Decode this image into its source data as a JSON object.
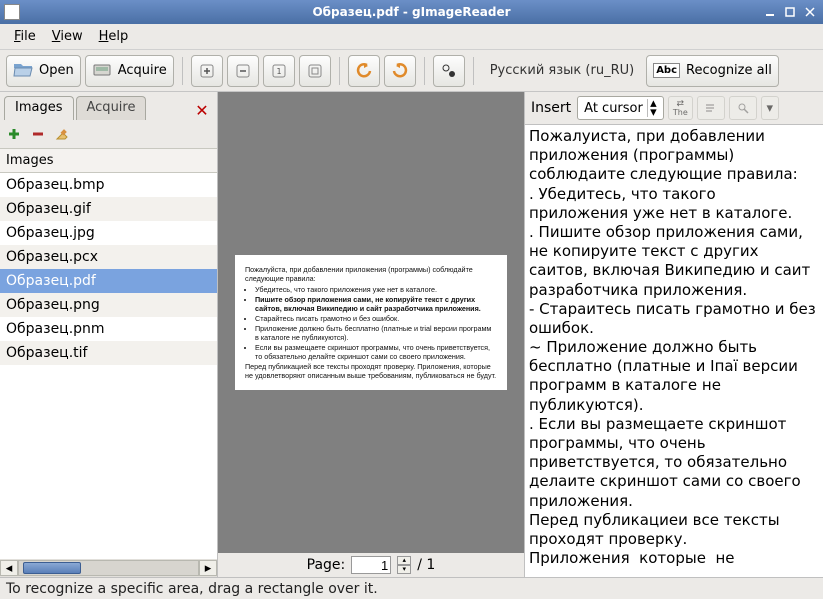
{
  "window": {
    "title": "Образец.pdf - gImageReader"
  },
  "menu": {
    "file": "File",
    "view": "View",
    "help": "Help"
  },
  "toolbar": {
    "open": "Open",
    "acquire": "Acquire",
    "language": "Русский язык (ru_RU)",
    "recognize_all": "Recognize all"
  },
  "left_panel": {
    "tab_images": "Images",
    "tab_acquire": "Acquire",
    "list_header": "Images",
    "files": [
      "Образец.bmp",
      "Образец.gif",
      "Образец.jpg",
      "Образец.pcx",
      "Образец.pdf",
      "Образец.png",
      "Образец.pnm",
      "Образец.tif"
    ],
    "selected_index": 4
  },
  "viewer": {
    "page_label": "Page:",
    "page_current": "1",
    "page_total": "/ 1",
    "doc": {
      "intro": "Пожалуйста, при добавлении приложения (программы) соблюдайте следующие правила:",
      "b1": "Убедитесь, что такого приложения уже нет в каталоге.",
      "b2": "Пишите обзор приложения сами, не копируйте текст с других сайтов, включая Википедию и сайт разработчика приложения.",
      "b3": "Старайтесь писать грамотно и без ошибок.",
      "b4": "Приложение должно быть бесплатно (платные и trial версии программ в каталоге не публикуются).",
      "b5": "Если вы размещаете скриншот программы, что очень приветствуется, то обязательно делайте скриншот сами со своего приложения.",
      "outro": "Перед публикацией все тексты проходят проверку. Приложения, которые не удовлетворяют описанным выше требованиям, публиковаться не будут."
    }
  },
  "output": {
    "insert_label": "Insert",
    "insert_mode": "At cursor",
    "the_label": "The",
    "text": "Пожалуиста, при добавлении приложения (программы) соблюдаите следующие правила:\n. Убедитесь, что такого приложения уже нет в каталоге.\n. Пишите обзор приложения сами, не копируите текст с других саитов, включая Википедию и саит разработчика приложения.\n- Стараитесь писать грамотно и без ошибок.\n~ Приложение должно быть бесплатно (платные и Іпаї версии программ в каталоге не публикуются).\n. Если вы размещаете скриншот программы, что очень приветствуется, то обязательно делаите скриншот сами со своего приложения.\nПеред публикациеи все тексты проходят проверку.\nПриложения  которые  не"
  },
  "status": {
    "text": "To recognize a specific area, drag a rectangle over it."
  }
}
